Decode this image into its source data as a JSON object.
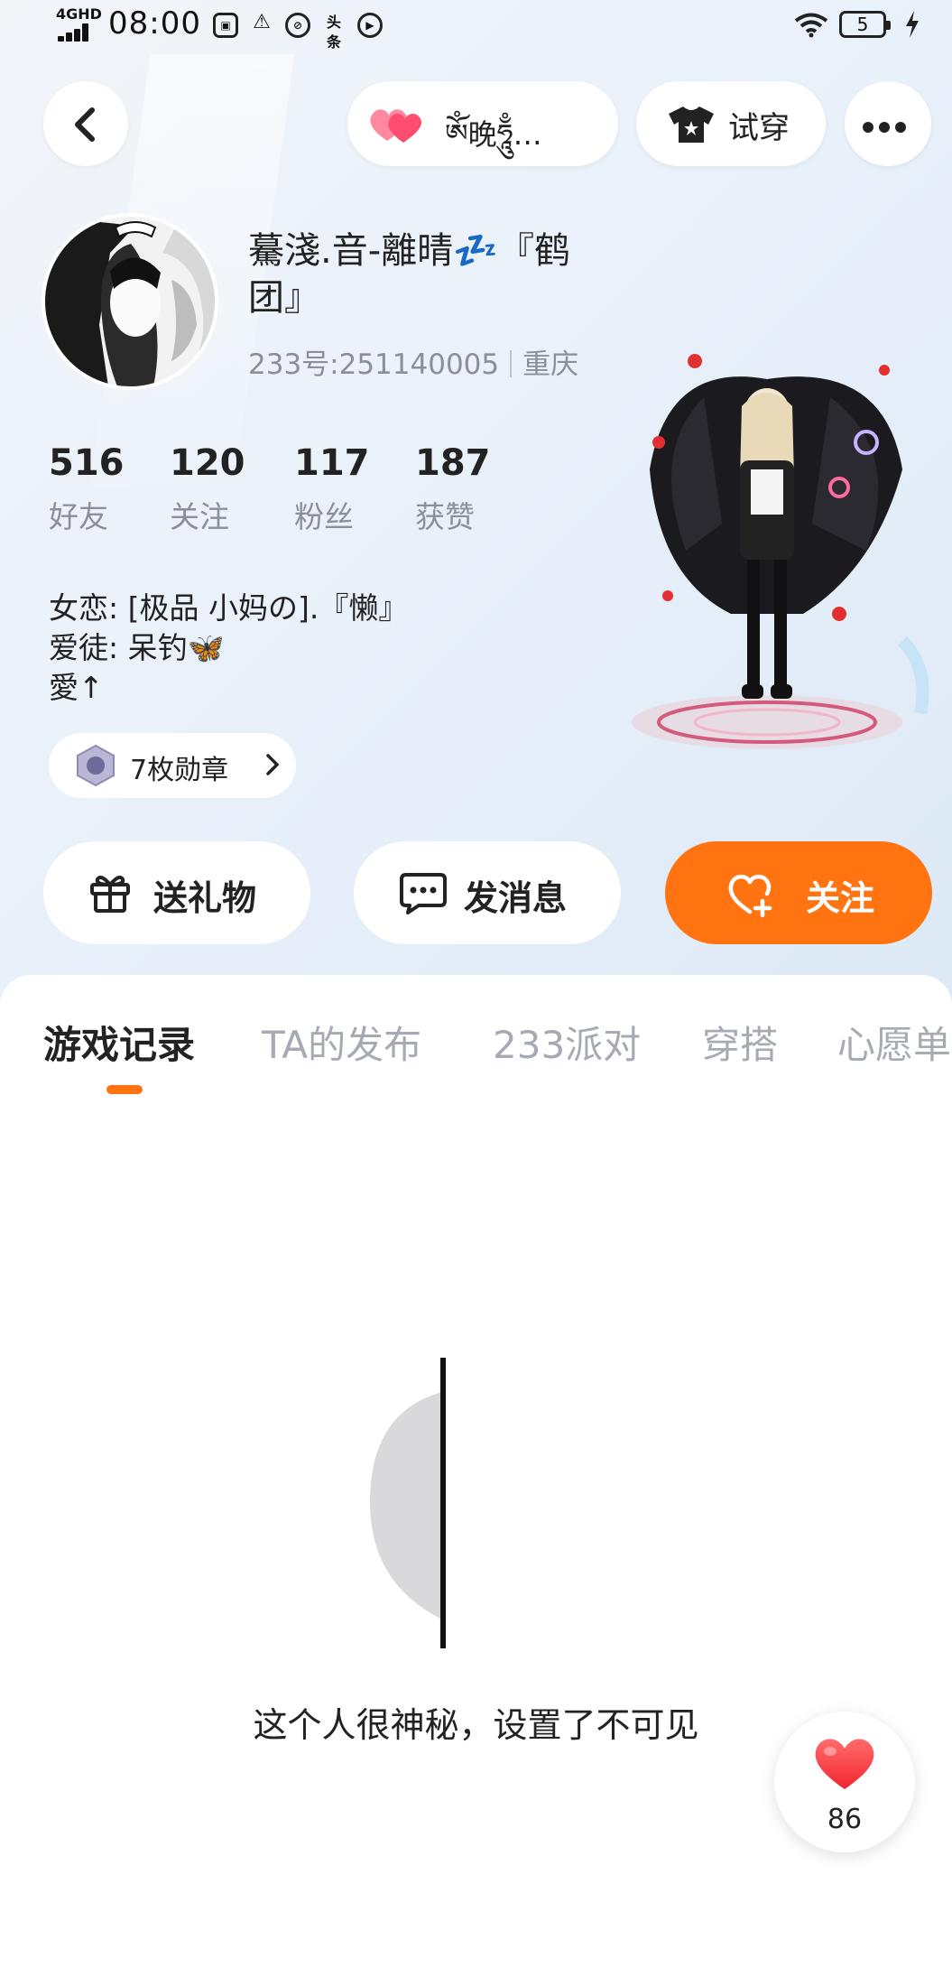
{
  "status_bar": {
    "network": "4GHD",
    "time": "08:00",
    "battery": "5",
    "app_icons": [
      "gallery-icon",
      "alert-icon",
      "cloud-icon",
      "头条",
      "play-icon"
    ]
  },
  "header": {
    "guard_name": "ཨོཾ晚ཧཱུྃ…",
    "tryon_label": "试穿"
  },
  "profile": {
    "name": "驀淺.音-離晴💤『鹤团』",
    "uid": "233号:251140005",
    "location": "重庆",
    "stats": [
      {
        "value": "516",
        "label": "好友"
      },
      {
        "value": "120",
        "label": "关注"
      },
      {
        "value": "117",
        "label": "粉丝"
      },
      {
        "value": "187",
        "label": "获赞"
      }
    ],
    "bio": [
      "女恋: [极品 小妈の].『懒』",
      "爱徒: 呆钓🦋",
      "愛↑"
    ],
    "medals": "7枚勋章"
  },
  "actions": {
    "gift": "送礼物",
    "message": "发消息",
    "follow": "关注"
  },
  "tabs": [
    "游戏记录",
    "TA的发布",
    "233派对",
    "穿搭",
    "心愿单"
  ],
  "empty_state": {
    "text": "这个人很神秘，设置了不可见"
  },
  "like_fab": {
    "count": "86"
  },
  "colors": {
    "accent": "#ff7411",
    "heart": "#ff4d5a",
    "muted": "#8a8f99"
  }
}
